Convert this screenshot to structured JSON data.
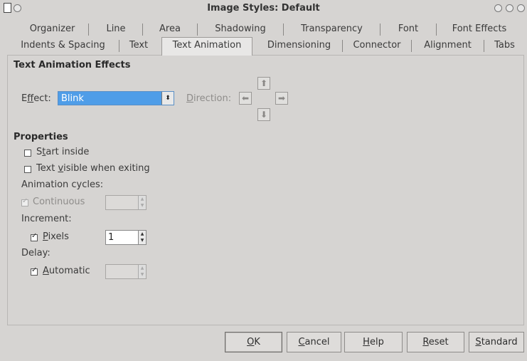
{
  "window": {
    "title": "Image Styles: Default"
  },
  "tabs_row1": [
    "Organizer",
    "Line",
    "Area",
    "Shadowing",
    "Transparency",
    "Font",
    "Font Effects"
  ],
  "tabs_row2": [
    "Indents & Spacing",
    "Text",
    "Text Animation",
    "Dimensioning",
    "Connector",
    "Alignment",
    "Tabs"
  ],
  "active_tab": "Text Animation",
  "effects": {
    "heading": "Text Animation Effects",
    "effect_label": "Effect:",
    "effect_value": "Blink",
    "direction_label": "Direction:",
    "direction_icons": [
      "arrow-up-icon",
      "arrow-left-icon",
      "arrow-right-icon",
      "arrow-down-icon"
    ]
  },
  "properties": {
    "heading": "Properties",
    "start_inside": {
      "label": "Start inside",
      "checked": false
    },
    "text_visible": {
      "label": "Text visible when exiting",
      "checked": false
    },
    "animation_cycles_label": "Animation cycles:",
    "continuous": {
      "label": "Continuous",
      "checked": true,
      "enabled": false,
      "value": ""
    },
    "increment_label": "Increment:",
    "pixels": {
      "label": "Pixels",
      "checked": true,
      "value": "1"
    },
    "delay_label": "Delay:",
    "automatic": {
      "label": "Automatic",
      "checked": true,
      "value": ""
    }
  },
  "buttons": {
    "ok": "OK",
    "cancel": "Cancel",
    "help": "Help",
    "reset": "Reset",
    "standard": "Standard"
  }
}
